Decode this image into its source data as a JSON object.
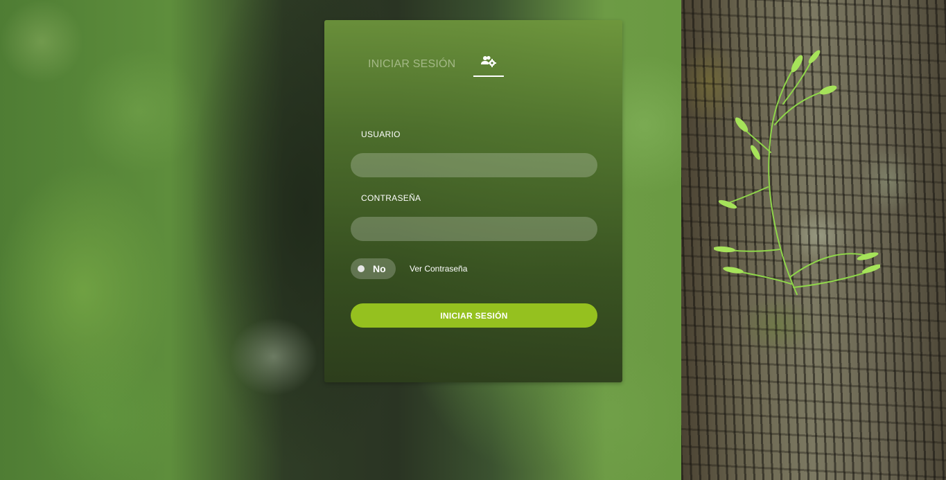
{
  "tabs": {
    "login_label": "INICIAR SESIÓN",
    "users_icon": "users-gear-icon"
  },
  "form": {
    "username_label": "USUARIO",
    "username_value": "",
    "password_label": "CONTRASEÑA",
    "password_value": "",
    "show_password_toggle": "No",
    "show_password_label": "Ver Contraseña",
    "submit_label": "INICIAR SESIÓN"
  },
  "colors": {
    "accent": "#95c11f",
    "card": "#4f7330"
  }
}
